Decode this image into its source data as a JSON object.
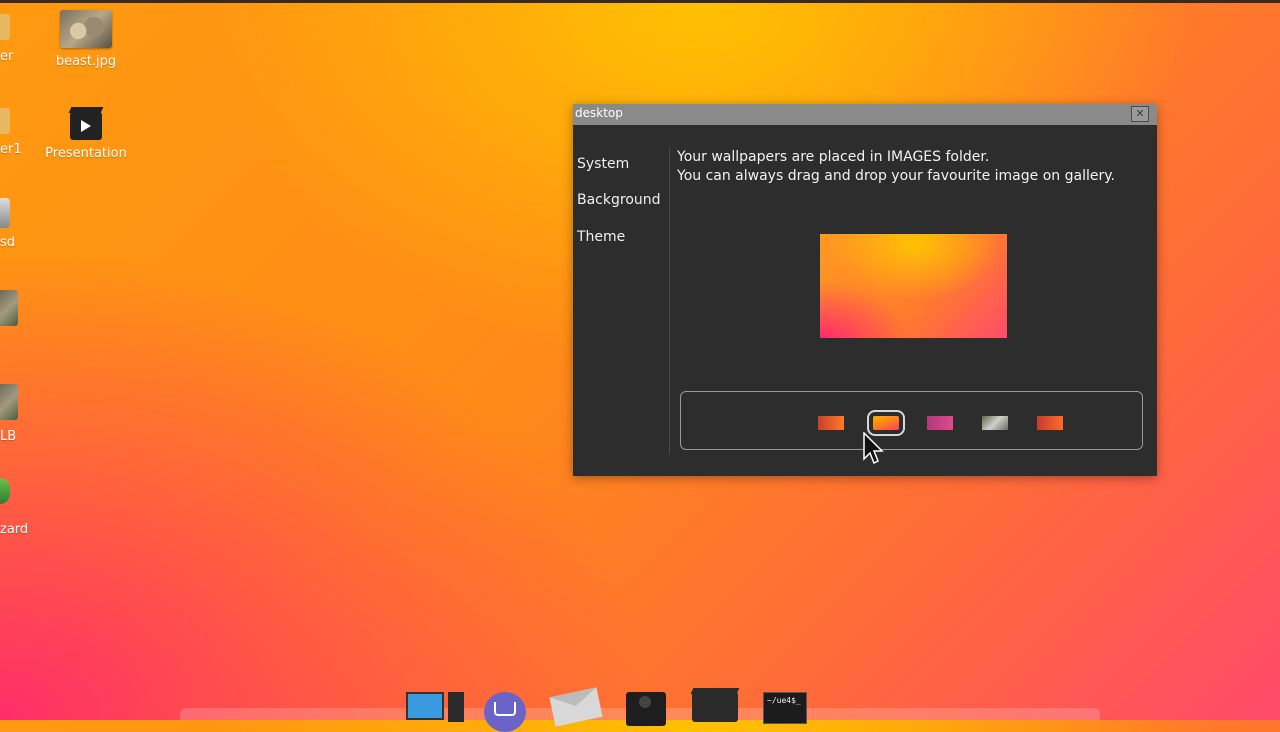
{
  "desktop": {
    "icons": [
      {
        "label": "beast.jpg"
      },
      {
        "label": "Presentation"
      }
    ],
    "edge_labels": [
      "er",
      "er1",
      "sd",
      "LB",
      "zard"
    ]
  },
  "window": {
    "title": "desktop",
    "close_glyph": "✕",
    "sidebar": [
      "System",
      "Background",
      "Theme"
    ],
    "info_line1": "Your wallpapers are placed in IMAGES folder.",
    "info_line2": "You can always drag and drop your favourite image on gallery.",
    "gallery": {
      "thumbnails": [
        {
          "name": "wallpaper-red-orange",
          "color": "#d9542a"
        },
        {
          "name": "wallpaper-orange-pink",
          "color": "#ff8a20",
          "selected": true
        },
        {
          "name": "wallpaper-magenta",
          "color": "#c23a7a"
        },
        {
          "name": "wallpaper-photo",
          "color": "#8a8a8a"
        },
        {
          "name": "wallpaper-red",
          "color": "#d94a2a"
        }
      ]
    }
  },
  "dock": {
    "items": [
      "computer-icon",
      "shop-basket-icon",
      "mail-icon",
      "speaker-icon",
      "video-clapper-icon",
      "terminal-icon"
    ],
    "terminal_text": "~/ue4$_"
  },
  "colors": {
    "window_bg": "#2d2d2d",
    "titlebar": "#8a8a8a",
    "wallpaper_orange": "#ff9a10",
    "wallpaper_pink": "#ff3a78"
  }
}
